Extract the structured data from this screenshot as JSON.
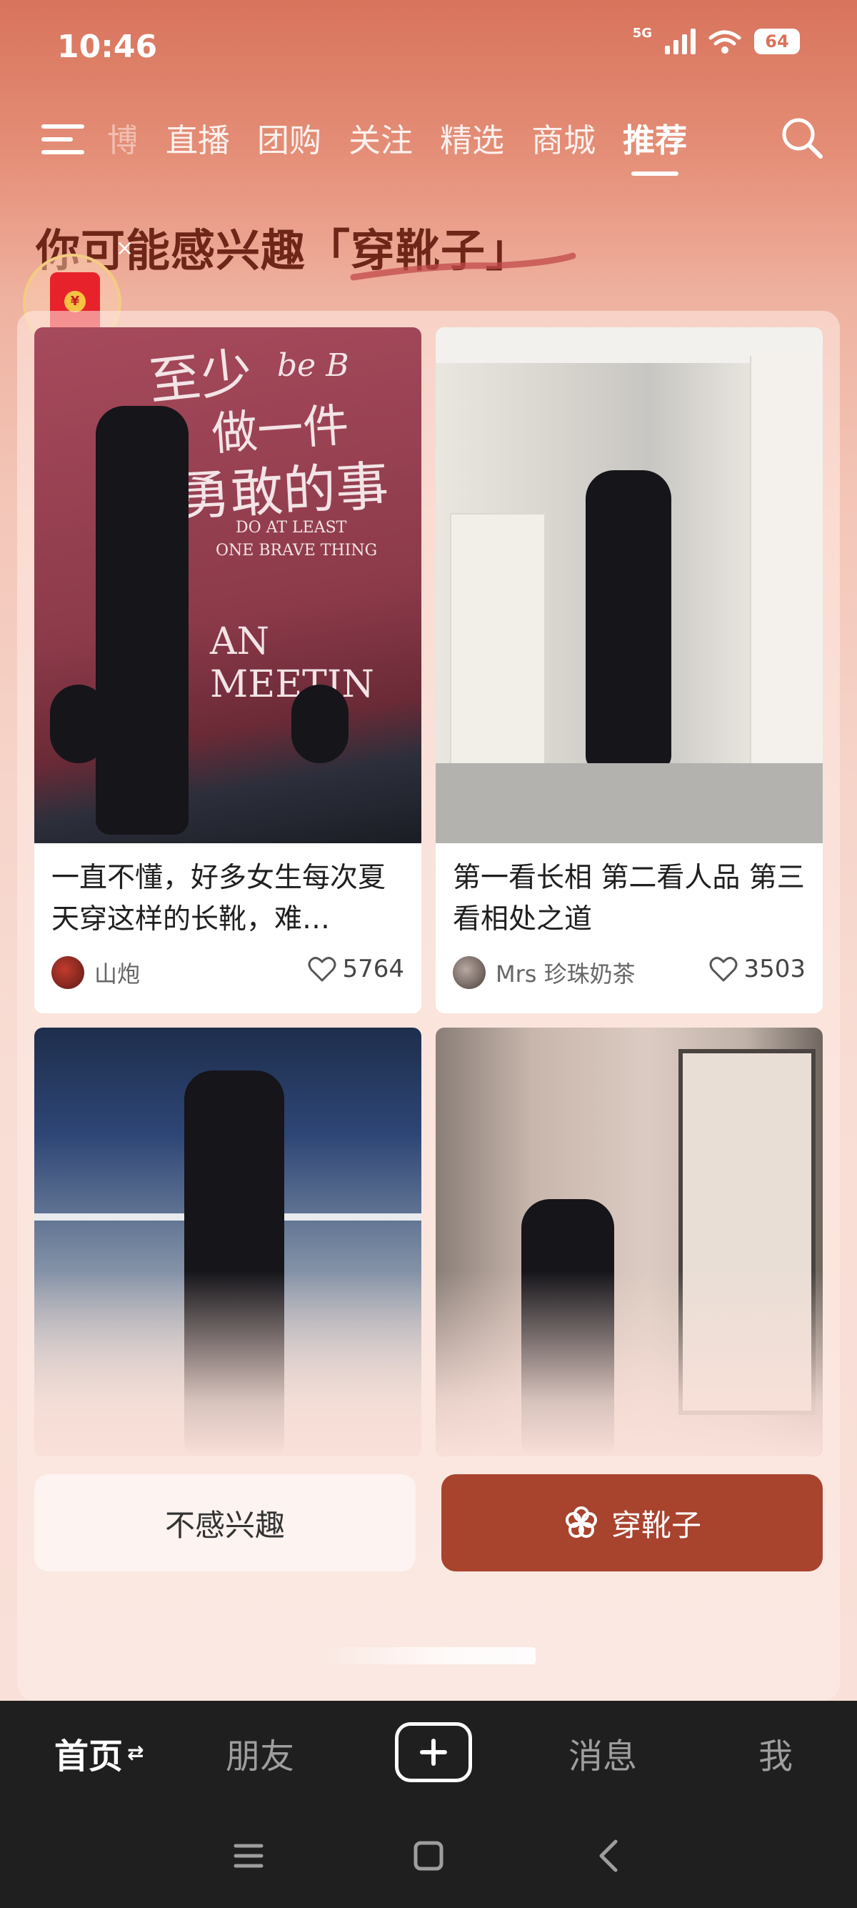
{
  "status_bar": {
    "time": "10:46",
    "network": "5G",
    "battery": "64"
  },
  "tabs": [
    {
      "label": "博"
    },
    {
      "label": "直播"
    },
    {
      "label": "团购"
    },
    {
      "label": "关注"
    },
    {
      "label": "精选"
    },
    {
      "label": "商城"
    },
    {
      "label": "推荐",
      "active": true
    }
  ],
  "heading": "你可能感兴趣「穿靴子」",
  "redpacket": {
    "coin": "¥",
    "close": "×"
  },
  "posts": [
    {
      "title": "一直不懂，好多女生每次夏天穿这样的长靴，难…",
      "author": "山炮",
      "likes": "5764",
      "image_text": [
        "至少",
        "做一件",
        "勇敢的事",
        "DO AT LEAST",
        "ONE BRAVE THING",
        "AN MEETIN"
      ]
    },
    {
      "title": "第一看长相 第二看人品 第三看相处之道",
      "author": "Mrs 珍珠奶茶",
      "likes": "3503"
    },
    {
      "title": "",
      "author": "",
      "likes": ""
    },
    {
      "title": "",
      "author": "",
      "likes": ""
    }
  ],
  "actions": {
    "not_interested": "不感兴趣",
    "interested": "穿靴子"
  },
  "bottom_nav": {
    "home": "首页",
    "friends": "朋友",
    "messages": "消息",
    "me": "我"
  },
  "colors": {
    "accent": "#a8432e",
    "heading": "#6e2618",
    "nav_bg": "#1f1f1f"
  }
}
